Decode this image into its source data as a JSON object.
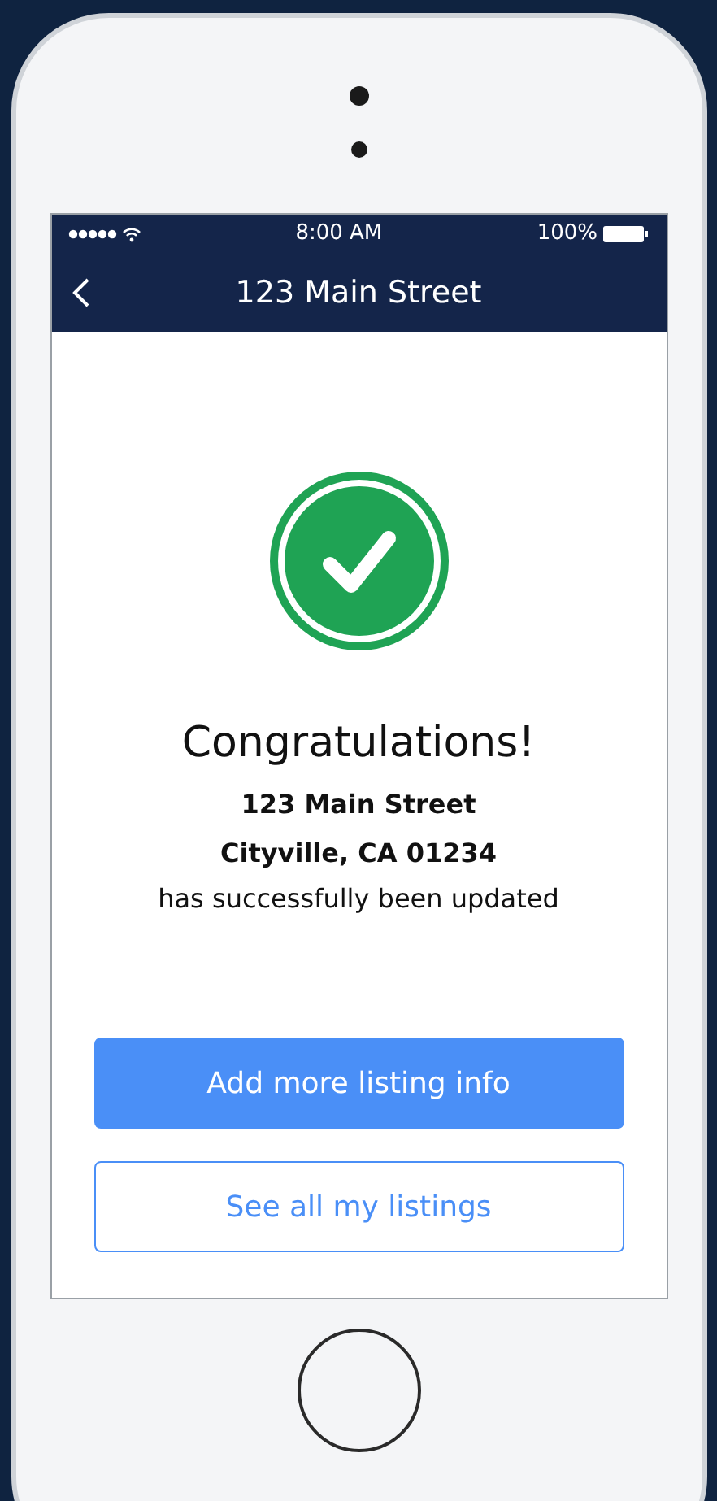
{
  "status_bar": {
    "time": "8:00 AM",
    "battery": "100%"
  },
  "nav": {
    "title": "123 Main Street"
  },
  "message": {
    "heading": "Congratulations!",
    "address_lines": [
      "123 Main Street",
      "Cityville, CA 01234"
    ],
    "note": "has successfully been updated"
  },
  "buttons": [
    {
      "label": "Add more listing info",
      "kind": "primary"
    },
    {
      "label": "See all my listings",
      "kind": "outline"
    }
  ]
}
